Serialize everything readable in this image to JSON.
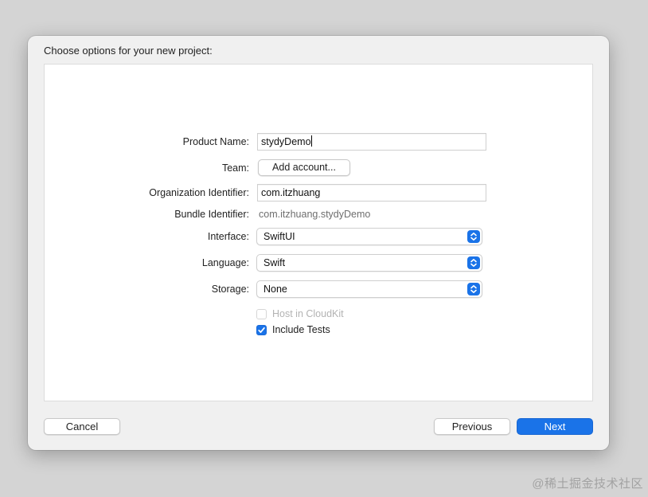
{
  "dialog": {
    "title": "Choose options for your new project:"
  },
  "form": {
    "product_name": {
      "label": "Product Name:",
      "value": "stydyDemo"
    },
    "team": {
      "label": "Team:",
      "button_label": "Add account..."
    },
    "organization_identifier": {
      "label": "Organization Identifier:",
      "value": "com.itzhuang"
    },
    "bundle_identifier": {
      "label": "Bundle Identifier:",
      "value": "com.itzhuang.stydyDemo"
    },
    "interface": {
      "label": "Interface:",
      "value": "SwiftUI"
    },
    "language": {
      "label": "Language:",
      "value": "Swift"
    },
    "storage": {
      "label": "Storage:",
      "value": "None"
    },
    "host_in_cloudkit": {
      "label": "Host in CloudKit",
      "checked": false,
      "enabled": false
    },
    "include_tests": {
      "label": "Include Tests",
      "checked": true,
      "enabled": true
    }
  },
  "footer": {
    "cancel_label": "Cancel",
    "previous_label": "Previous",
    "next_label": "Next"
  },
  "watermark": "@稀土掘金技术社区",
  "colors": {
    "accent": "#1a73e8",
    "window_background": "#f0f0f0",
    "screen_background": "#d4d4d4"
  },
  "icons": {
    "popup_indicator": "chevron-up-down-icon",
    "checkmark": "checkmark-icon"
  }
}
